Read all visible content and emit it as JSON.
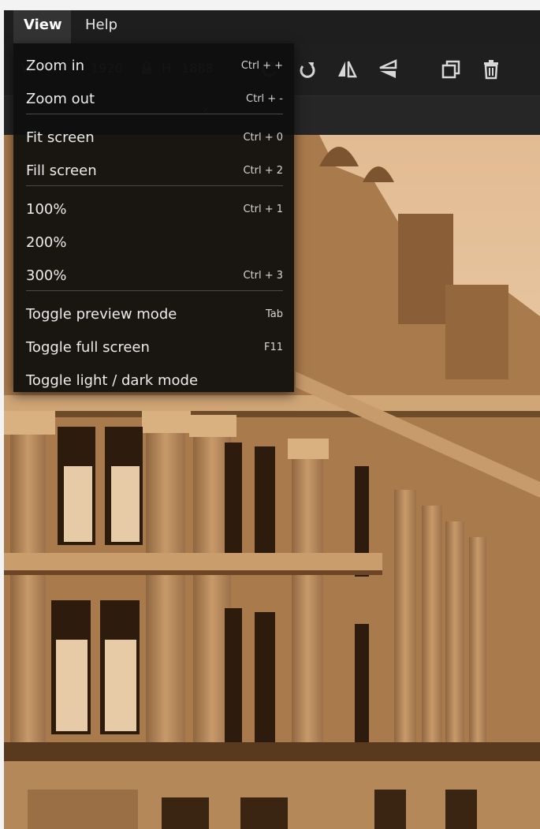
{
  "menubar": {
    "items": [
      {
        "label": "View"
      },
      {
        "label": "Help"
      }
    ]
  },
  "toolbar": {
    "width_label": "W",
    "width_value": "1920",
    "height_label": "H",
    "height_value": "1888",
    "icons": [
      "rotate-left-icon",
      "rotate-right-icon",
      "flip-horizontal-icon",
      "flip-vertical-icon",
      "duplicate-icon",
      "delete-icon"
    ]
  },
  "view_menu": {
    "items": [
      {
        "label": "Zoom in",
        "shortcut": "Ctrl + +"
      },
      {
        "label": "Zoom out",
        "shortcut": "Ctrl + -"
      },
      {
        "label": "Fit screen",
        "shortcut": "Ctrl + 0"
      },
      {
        "label": "Fill screen",
        "shortcut": "Ctrl + 2"
      },
      {
        "label": "100%",
        "shortcut": "Ctrl + 1"
      },
      {
        "label": "200%",
        "shortcut": ""
      },
      {
        "label": "300%",
        "shortcut": "Ctrl + 3"
      },
      {
        "label": "Toggle preview mode",
        "shortcut": "Tab"
      },
      {
        "label": "Toggle full screen",
        "shortcut": "F11"
      },
      {
        "label": "Toggle light / dark mode",
        "shortcut": ""
      }
    ]
  },
  "colors": {
    "accent": "#333333",
    "sepia_light": "#e9c9a2",
    "sepia_mid": "#b3875a",
    "sepia_dark": "#5a3a1e"
  }
}
